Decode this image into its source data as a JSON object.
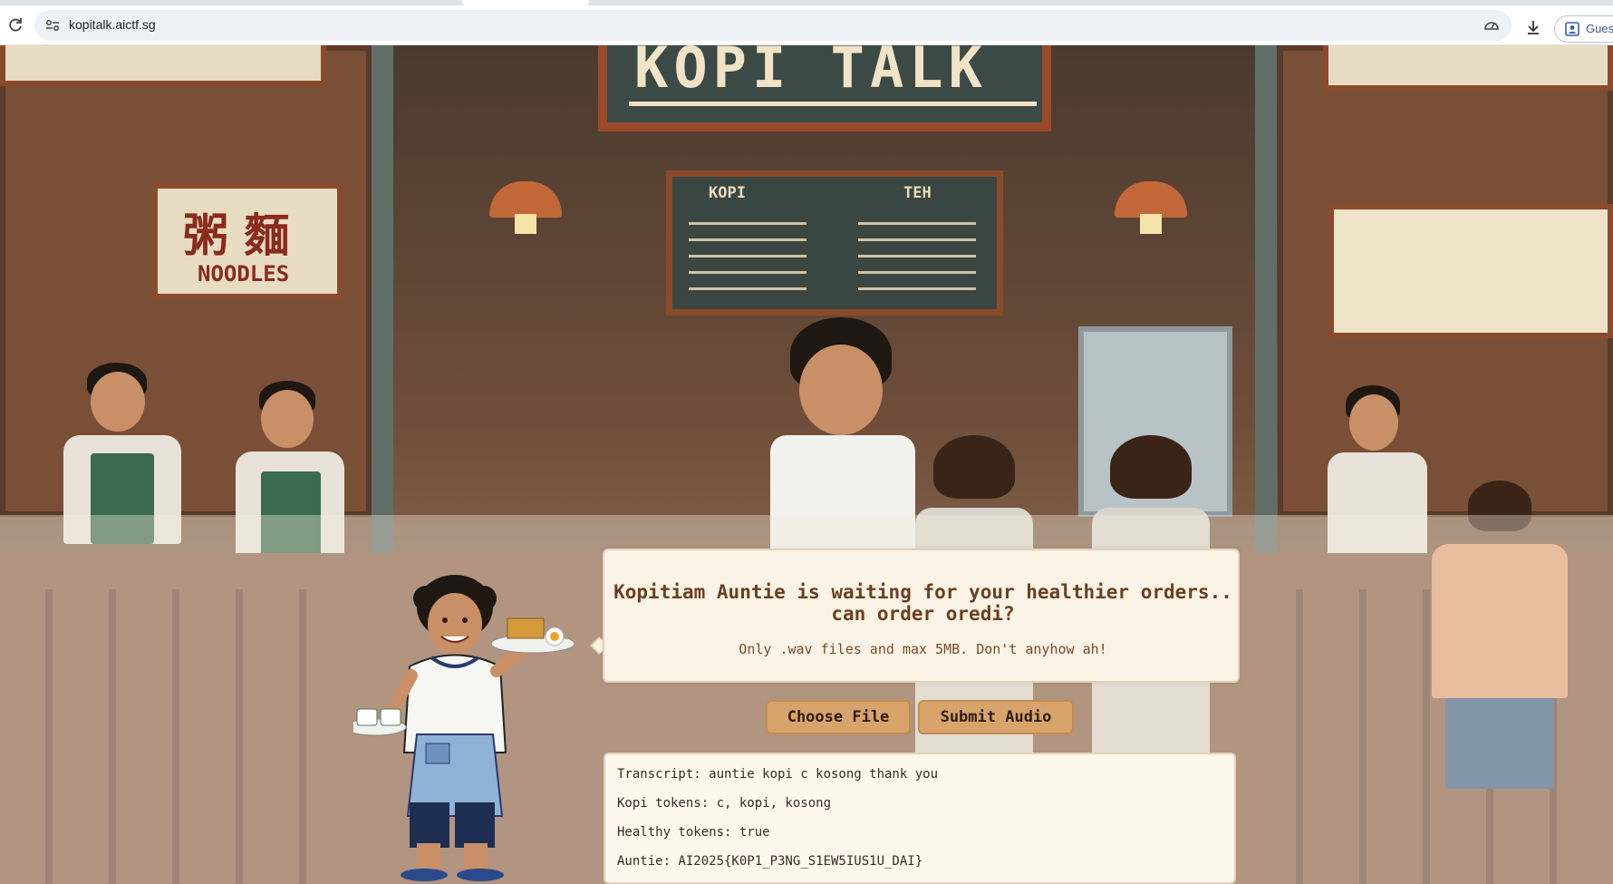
{
  "browser": {
    "url": "kopitalk.aictf.sg",
    "profile_label": "Guest"
  },
  "scene": {
    "main_sign": "KOPI TALK",
    "left_sign_hanzi": "粥 麵",
    "left_sign_latin": "NOODLES",
    "menu_board": {
      "col1_header": "KOPI",
      "col2_header": "TEH"
    }
  },
  "panel": {
    "title": "Kopitiam Auntie is waiting for your healthier orders.. can order oredi?",
    "subtitle": "Only .wav files and max 5MB. Don't anyhow ah!"
  },
  "buttons": {
    "choose_file": "Choose File",
    "submit_audio": "Submit Audio"
  },
  "result": {
    "transcript": "Transcript: auntie kopi c kosong thank you",
    "kopi_tokens": "Kopi tokens: c, kopi, kosong",
    "healthy_tokens": "Healthy tokens: true",
    "auntie": "Auntie: AI2025{K0P1_P3NG_S1EW5IUS1U_DAI}"
  },
  "icons": [
    "reload-icon",
    "site-info-icon",
    "performance-icon",
    "download-icon",
    "profile-icon"
  ]
}
